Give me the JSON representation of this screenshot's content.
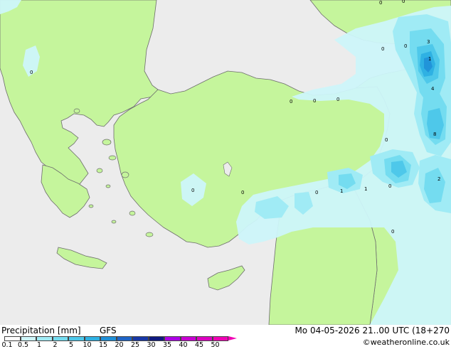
{
  "footer": {
    "title": "Precipitation [mm]",
    "model": "GFS",
    "datetime": "Mo 04-05-2026 21..00 UTC (18+270",
    "credit": "©weatheronline.co.uk"
  },
  "legend": {
    "labels": [
      "0.1",
      "0.5",
      "1",
      "2",
      "5",
      "10",
      "15",
      "20",
      "25",
      "30",
      "35",
      "40",
      "45",
      "50"
    ],
    "colors": [
      "#fdfdfd",
      "#cdf5fa",
      "#a0ebf5",
      "#74dcf0",
      "#4ec8ea",
      "#2fb1e3",
      "#1f8fd7",
      "#1f64c6",
      "#1938a6",
      "#0f1a7f",
      "#ad00e6",
      "#c800d2",
      "#dc00c0",
      "#f000b4"
    ]
  },
  "map_labels": [
    {
      "text": "0"
    },
    {
      "text": "0"
    },
    {
      "text": "0"
    },
    {
      "text": "0"
    },
    {
      "text": "0"
    },
    {
      "text": "3"
    },
    {
      "text": "1"
    },
    {
      "text": "4"
    },
    {
      "text": "8"
    },
    {
      "text": "0"
    },
    {
      "text": "0"
    },
    {
      "text": "0"
    },
    {
      "text": "0"
    },
    {
      "text": "1"
    },
    {
      "text": "1"
    },
    {
      "text": "0"
    },
    {
      "text": "2"
    },
    {
      "text": "0"
    },
    {
      "text": "0"
    },
    {
      "text": "0"
    },
    {
      "text": "0"
    }
  ],
  "colors": {
    "land": "#c5f59c",
    "sea": "#ececec",
    "coast": "#6d6d6d"
  }
}
